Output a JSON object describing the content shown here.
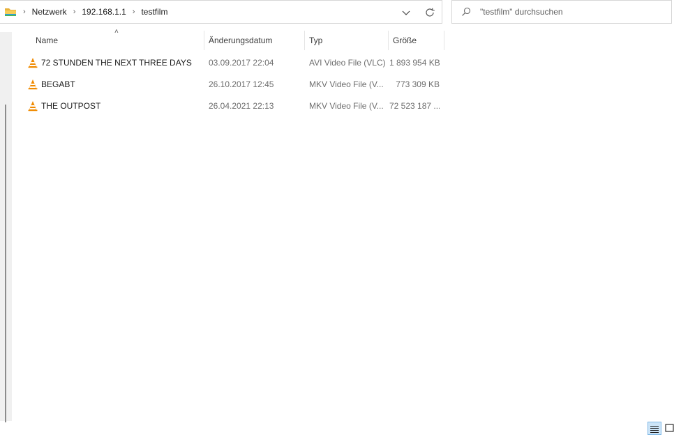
{
  "breadcrumb": {
    "items": [
      "Netzwerk",
      "192.168.1.1",
      "testfilm"
    ]
  },
  "search": {
    "placeholder": "\"testfilm\" durchsuchen"
  },
  "columns": {
    "name": "Name",
    "date": "Änderungsdatum",
    "type": "Typ",
    "size": "Größe"
  },
  "files": [
    {
      "name": "72 STUNDEN THE NEXT THREE DAYS",
      "date": "03.09.2017 22:04",
      "type": "AVI Video File (VLC)",
      "size": "1 893 954 KB"
    },
    {
      "name": "BEGABT",
      "date": "26.10.2017 12:45",
      "type": "MKV Video File (V...",
      "size": "773 309 KB"
    },
    {
      "name": "THE OUTPOST",
      "date": "26.04.2021 22:13",
      "type": "MKV Video File (V...",
      "size": "72 523 187 ..."
    }
  ],
  "colors": {
    "accent": "#0067c0",
    "vlc_orange": "#f08a00"
  },
  "icons": [
    "folder-icon",
    "chevron-right-icon",
    "chevron-down-icon",
    "refresh-icon",
    "search-icon",
    "vlc-icon",
    "sort-up-icon",
    "details-view-icon",
    "tiles-view-icon"
  ]
}
